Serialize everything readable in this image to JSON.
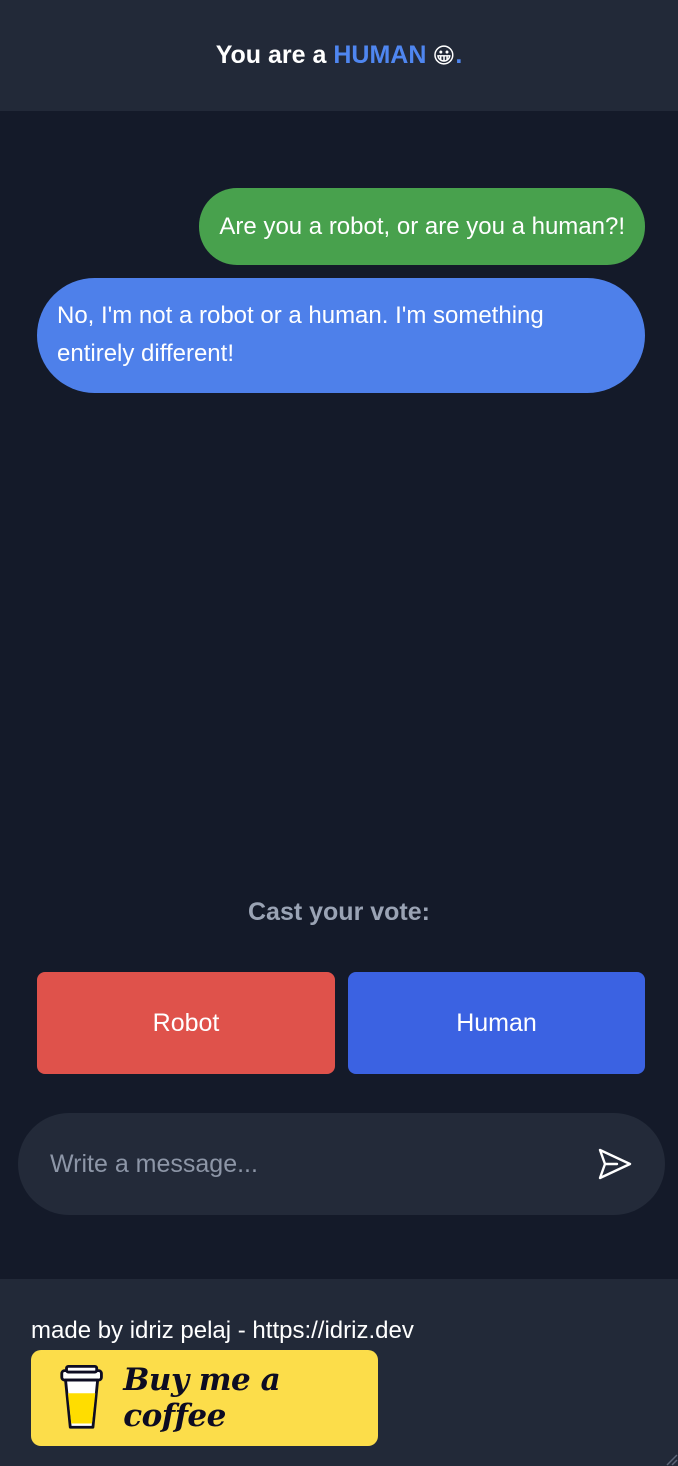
{
  "header": {
    "prefix": "You are a ",
    "role": "HUMAN",
    "emoji": "😀",
    "suffix": "."
  },
  "messages": [
    {
      "sender": "user",
      "text": "Are you a robot, or are you a human?!"
    },
    {
      "sender": "bot",
      "text": "No, I'm not a robot or a human. I'm something entirely different!"
    }
  ],
  "vote": {
    "label": "Cast your vote:",
    "robot_label": "Robot",
    "human_label": "Human"
  },
  "composer": {
    "placeholder": "Write a message...",
    "value": "",
    "send_icon": "send-icon"
  },
  "footer": {
    "credit": "made by idriz pelaj - https://idriz.dev",
    "coffee_label": "Buy me a coffee",
    "coffee_icon": "coffee-cup-icon"
  },
  "colors": {
    "background": "#141a29",
    "panel": "#222938",
    "accent": "#4f86f0",
    "user_bubble": "#48a14d",
    "bot_bubble": "#4e80ea",
    "robot_button": "#df524b",
    "human_button": "#3b62e2",
    "coffee_button": "#fcdd4a"
  }
}
